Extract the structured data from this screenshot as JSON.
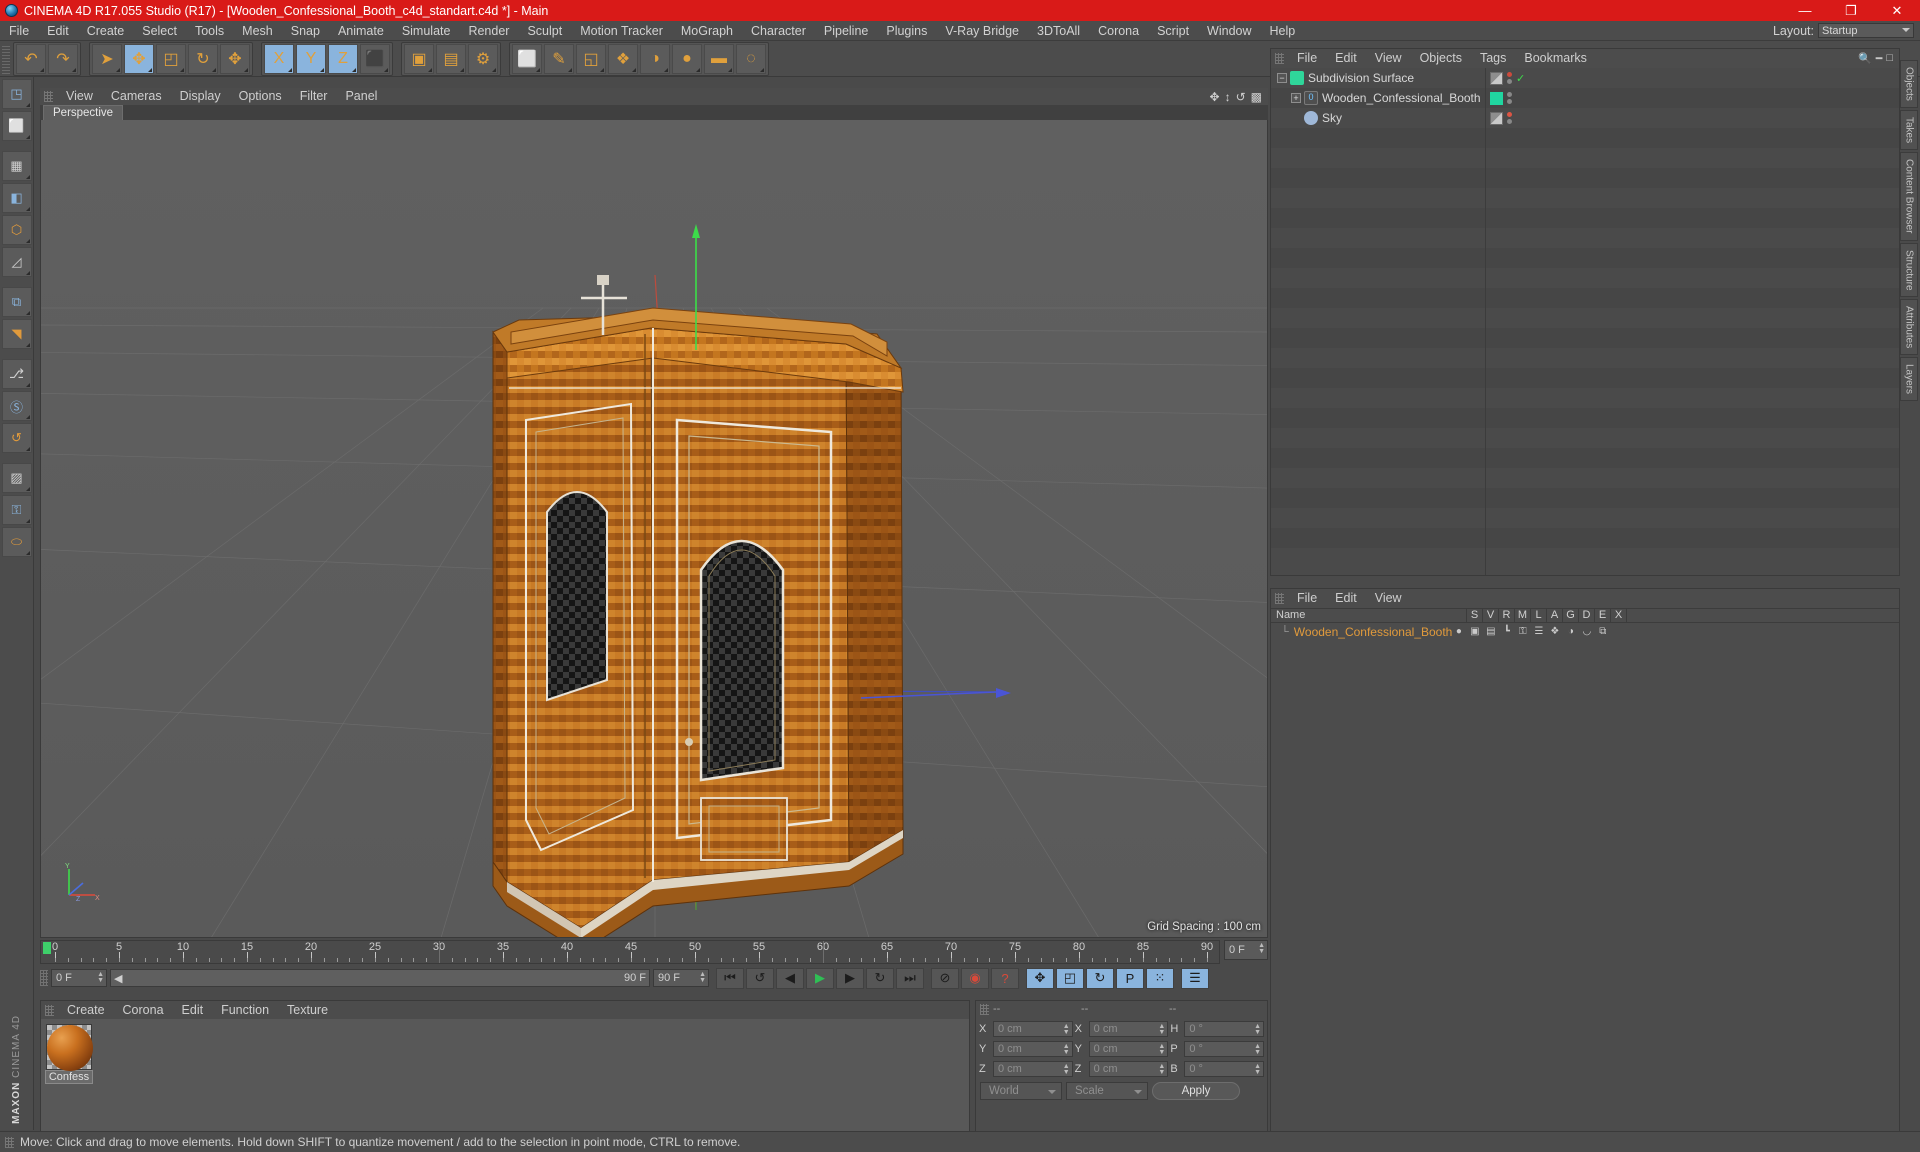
{
  "window": {
    "title": "CINEMA 4D R17.055 Studio (R17) - [Wooden_Confessional_Booth_c4d_standart.c4d *] - Main",
    "minimize": "—",
    "maximize": "❐",
    "close": "✕"
  },
  "menubar": {
    "items": [
      {
        "label": "File"
      },
      {
        "label": "Edit"
      },
      {
        "label": "Create"
      },
      {
        "label": "Select"
      },
      {
        "label": "Tools"
      },
      {
        "label": "Mesh"
      },
      {
        "label": "Snap"
      },
      {
        "label": "Animate"
      },
      {
        "label": "Simulate"
      },
      {
        "label": "Render"
      },
      {
        "label": "Sculpt"
      },
      {
        "label": "Motion Tracker"
      },
      {
        "label": "MoGraph"
      },
      {
        "label": "Character"
      },
      {
        "label": "Pipeline"
      },
      {
        "label": "Plugins"
      },
      {
        "label": "V-Ray Bridge"
      },
      {
        "label": "3DToAll"
      },
      {
        "label": "Corona"
      },
      {
        "label": "Script"
      },
      {
        "label": "Window"
      },
      {
        "label": "Help"
      }
    ],
    "layout_label": "Layout:",
    "layout_value": "Startup"
  },
  "toolbar": {
    "groups": [
      {
        "name": "undo-redo",
        "buttons": [
          {
            "name": "undo-button",
            "glyph": "↶",
            "active": false
          },
          {
            "name": "redo-button",
            "glyph": "↷",
            "active": false
          }
        ]
      },
      {
        "name": "transform-tools",
        "buttons": [
          {
            "name": "select-tool-button",
            "glyph": "➤",
            "active": false
          },
          {
            "name": "move-tool-button",
            "glyph": "✥",
            "active": true
          },
          {
            "name": "scale-tool-button",
            "glyph": "◰",
            "active": false
          },
          {
            "name": "rotate-tool-button",
            "glyph": "↻",
            "active": false
          },
          {
            "name": "world-move-button",
            "glyph": "✥",
            "active": false
          }
        ]
      },
      {
        "name": "axis-locks",
        "buttons": [
          {
            "name": "lock-x-axis-button",
            "glyph": "X",
            "active": true
          },
          {
            "name": "lock-y-axis-button",
            "glyph": "Y",
            "active": true
          },
          {
            "name": "lock-z-axis-button",
            "glyph": "Z",
            "active": true
          },
          {
            "name": "world-object-coord-button",
            "glyph": "⬛",
            "active": false
          }
        ]
      },
      {
        "name": "render-tools",
        "buttons": [
          {
            "name": "render-view-button",
            "glyph": "▣",
            "active": false
          },
          {
            "name": "render-to-picture-viewer-button",
            "glyph": "▤",
            "active": false
          },
          {
            "name": "render-settings-button",
            "glyph": "⚙",
            "active": false
          }
        ]
      },
      {
        "name": "object-creation",
        "buttons": [
          {
            "name": "add-cube-button",
            "glyph": "⬜",
            "active": false
          },
          {
            "name": "add-spline-button",
            "glyph": "✎",
            "active": false
          },
          {
            "name": "add-generator-button",
            "glyph": "◱",
            "active": false
          },
          {
            "name": "add-modeling-object-button",
            "glyph": "❖",
            "active": false
          },
          {
            "name": "add-deformer-button",
            "glyph": "◑",
            "active": false
          },
          {
            "name": "add-environment-button",
            "glyph": "●",
            "active": false
          },
          {
            "name": "add-camera-button",
            "glyph": "▬",
            "active": false
          },
          {
            "name": "add-light-button",
            "glyph": "◌",
            "active": false
          }
        ]
      }
    ]
  },
  "left_palette": {
    "buttons": [
      {
        "name": "make-editable-button",
        "glyph": "◳"
      },
      {
        "name": "model-mode-button",
        "glyph": "⬜"
      },
      {
        "name": "texture-mode-button",
        "glyph": "▦"
      },
      {
        "name": "polygon-mode-button",
        "glyph": "◧"
      },
      {
        "name": "point-mode-button",
        "glyph": "⬡"
      },
      {
        "name": "edge-mode-button",
        "glyph": "◿"
      },
      {
        "name": "object-axis-mode-button",
        "glyph": "⧉"
      },
      {
        "name": "workplane-button",
        "glyph": "◥"
      },
      {
        "name": "enable-axis-button",
        "glyph": "⎇"
      },
      {
        "name": "snap-settings-button",
        "glyph": "Ⓢ"
      },
      {
        "name": "viewport-solo-button",
        "glyph": "↺"
      },
      {
        "name": "texture-axis-button",
        "glyph": "▨"
      },
      {
        "name": "lock-workplane-button",
        "glyph": "⚿"
      },
      {
        "name": "planar-workplane-button",
        "glyph": "⬭"
      }
    ],
    "brand_line1": "MAXON",
    "brand_line2": "CINEMA 4D"
  },
  "viewport": {
    "menu_items": [
      {
        "label": "View"
      },
      {
        "label": "Cameras"
      },
      {
        "label": "Display"
      },
      {
        "label": "Options"
      },
      {
        "label": "Filter"
      },
      {
        "label": "Panel"
      }
    ],
    "tab_label": "Perspective",
    "grid_spacing": "Grid Spacing : 100 cm",
    "corner_icons": [
      {
        "name": "pan-viewport-icon",
        "glyph": "✥"
      },
      {
        "name": "zoom-viewport-icon",
        "glyph": "↕"
      },
      {
        "name": "rotate-viewport-icon",
        "glyph": "↺"
      },
      {
        "name": "maximize-viewport-icon",
        "glyph": "◱"
      }
    ],
    "axis_labels": {
      "y": "Y",
      "x": "X",
      "z": "Z"
    }
  },
  "timeline": {
    "ticks": [
      "0",
      "5",
      "10",
      "15",
      "20",
      "25",
      "30",
      "35",
      "40",
      "45",
      "50",
      "55",
      "60",
      "65",
      "70",
      "75",
      "80",
      "85",
      "90"
    ],
    "current_frame_field": "0 F",
    "start_field": "0 F",
    "preview_min": "0 F",
    "preview_max": "90 F",
    "end_field": "90 F",
    "playback_buttons": [
      {
        "name": "go-to-start-button",
        "glyph": "⏮"
      },
      {
        "name": "play-backwards-frame-button",
        "glyph": "↺"
      },
      {
        "name": "previous-frame-button",
        "glyph": "◀"
      },
      {
        "name": "play-button",
        "glyph": "▶"
      },
      {
        "name": "next-frame-button",
        "glyph": "▶"
      },
      {
        "name": "play-forwards-frame-button",
        "glyph": "↻"
      },
      {
        "name": "go-to-end-button",
        "glyph": "⏭"
      }
    ],
    "record_buttons": [
      {
        "name": "autokeying-button",
        "glyph": "⊘"
      },
      {
        "name": "record-active-objects-button",
        "glyph": "◉"
      },
      {
        "name": "keyframe-selection-button",
        "glyph": "?"
      }
    ],
    "key_toggle_buttons": [
      {
        "name": "position-key-button",
        "glyph": "✥"
      },
      {
        "name": "scale-key-button",
        "glyph": "◰"
      },
      {
        "name": "rotation-key-button",
        "glyph": "↻"
      },
      {
        "name": "parameter-key-button",
        "glyph": "P"
      },
      {
        "name": "point-level-animation-button",
        "glyph": "⁙"
      }
    ],
    "timeline_toggle": {
      "name": "toggle-timeline-button",
      "glyph": "☰"
    }
  },
  "material_manager": {
    "menu_items": [
      {
        "label": "Create"
      },
      {
        "label": "Corona"
      },
      {
        "label": "Edit"
      },
      {
        "label": "Function"
      },
      {
        "label": "Texture"
      }
    ],
    "materials": [
      {
        "name": "Confess"
      }
    ]
  },
  "coordinates": {
    "header_position": "--",
    "header_size": "--",
    "header_rotation": "--",
    "rows": [
      {
        "label_pos": "X",
        "value_pos": "0 cm",
        "label_size": "X",
        "value_size": "0 cm",
        "label_rot": "H",
        "value_rot": "0 °"
      },
      {
        "label_pos": "Y",
        "value_pos": "0 cm",
        "label_size": "Y",
        "value_size": "0 cm",
        "label_rot": "P",
        "value_rot": "0 °"
      },
      {
        "label_pos": "Z",
        "value_pos": "0 cm",
        "label_size": "Z",
        "value_size": "0 cm",
        "label_rot": "B",
        "value_rot": "0 °"
      }
    ],
    "coord_system": "World",
    "size_mode": "Scale",
    "apply_label": "Apply"
  },
  "object_manager": {
    "menu_items": [
      {
        "label": "File"
      },
      {
        "label": "Edit"
      },
      {
        "label": "View"
      },
      {
        "label": "Objects"
      },
      {
        "label": "Tags"
      },
      {
        "label": "Bookmarks"
      }
    ],
    "objects": [
      {
        "name": "Subdivision Surface",
        "depth": 0,
        "expander": "−",
        "icon": "subdivision-surface-icon",
        "icon_color": "#2fd69a",
        "swatch_type": "dual",
        "dot_top": "#cc4a3c",
        "dot_bottom": "#888888",
        "has_check": true
      },
      {
        "name": "Wooden_Confessional_Booth",
        "depth": 1,
        "expander": "+",
        "icon": "polygon-object-icon",
        "icon_color": "#5aa5dd",
        "swatch_type": "green",
        "dot_top": "#888888",
        "dot_bottom": "#888888",
        "has_check": false
      },
      {
        "name": "Sky",
        "depth": 1,
        "expander": "",
        "icon": "sky-object-icon",
        "icon_color": "#9fb8d8",
        "swatch_type": "dual",
        "dot_top": "#dd5544",
        "dot_bottom": "#888888",
        "has_check": false
      }
    ]
  },
  "layer_manager": {
    "menu_items": [
      {
        "label": "File"
      },
      {
        "label": "Edit"
      },
      {
        "label": "View"
      }
    ],
    "name_column": "Name",
    "columns": [
      "S",
      "V",
      "R",
      "M",
      "L",
      "A",
      "G",
      "D",
      "E",
      "X"
    ],
    "rows": [
      {
        "name": "Wooden_Confessional_Booth",
        "color": "#20d6a0",
        "icons": [
          {
            "name": "solo-icon",
            "glyph": "●"
          },
          {
            "name": "visible-icon",
            "glyph": "▣"
          },
          {
            "name": "render-icon",
            "glyph": "▤"
          },
          {
            "name": "manager-icon",
            "glyph": "┗"
          },
          {
            "name": "locked-icon",
            "glyph": "⚿"
          },
          {
            "name": "animation-icon",
            "glyph": "☰"
          },
          {
            "name": "generators-icon",
            "glyph": "❖"
          },
          {
            "name": "deformers-icon",
            "glyph": "◑"
          },
          {
            "name": "expressions-icon",
            "glyph": "◡"
          },
          {
            "name": "xpresso-icon",
            "glyph": "⧉"
          }
        ]
      }
    ]
  },
  "edge_tabs": [
    {
      "label": "Objects"
    },
    {
      "label": "Takes"
    },
    {
      "label": "Content Browser"
    },
    {
      "label": "Structure"
    },
    {
      "label": "Attributes"
    },
    {
      "label": "Layers"
    }
  ],
  "statusbar": {
    "message": "Move: Click and drag to move elements. Hold down SHIFT to quantize movement / add to the selection in point mode, CTRL to remove."
  },
  "colors": {
    "title_red": "#d91a18",
    "panel_gray": "#4c4c4c",
    "viewport_gray": "#5b5b5b",
    "accent_orange": "#e09a3c",
    "accent_green": "#20d6a0",
    "active_blue": "#8ab4dd"
  }
}
